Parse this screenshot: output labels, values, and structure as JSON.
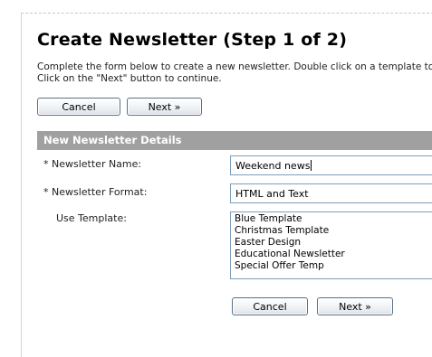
{
  "page": {
    "title": "Create Newsletter (Step 1 of 2)",
    "instructions_line1": "Complete the form below to create a new newsletter. Double click on a template to",
    "instructions_line2": "Click on the \"Next\" button to continue."
  },
  "buttons": {
    "cancel": "Cancel",
    "next": "Next »"
  },
  "section": {
    "header": "New Newsletter Details"
  },
  "form": {
    "name_label": "* Newsletter Name:",
    "name_value": "Weekend news",
    "format_label": "* Newsletter Format:",
    "format_value": "HTML and Text",
    "template_label": "Use Template:",
    "templates": [
      "Blue Template",
      "Christmas Template",
      "Easter Design",
      "Educational Newsletter",
      "Special Offer Temp"
    ]
  }
}
